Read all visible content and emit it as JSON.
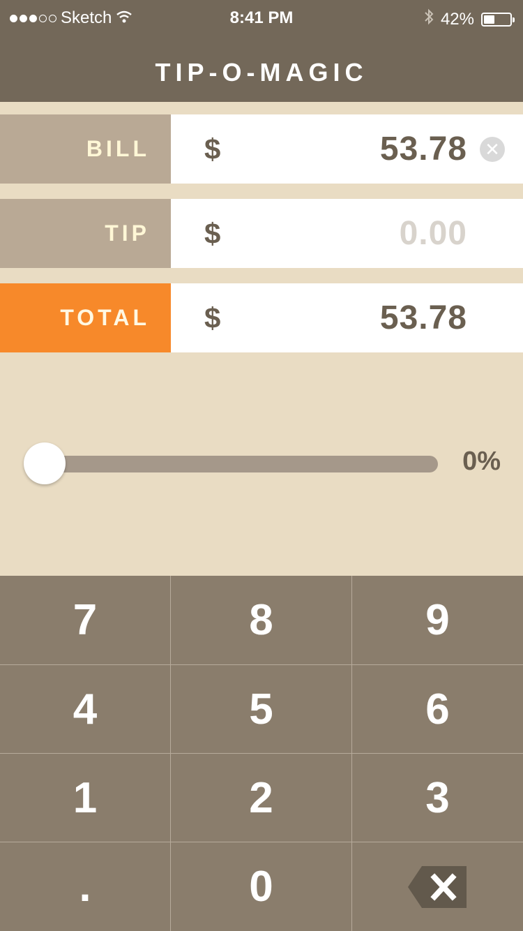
{
  "status_bar": {
    "carrier": "Sketch",
    "time": "8:41 PM",
    "battery_percent": "42%",
    "battery_level": 0.42,
    "signal_bars_filled": 3,
    "signal_bars_total": 5
  },
  "app": {
    "title": "TIP-O-MAGIC"
  },
  "rows": {
    "bill": {
      "label": "BILL",
      "currency": "$",
      "value": "53.78"
    },
    "tip": {
      "label": "TIP",
      "currency": "$",
      "placeholder": "0.00"
    },
    "total": {
      "label": "TOTAL",
      "currency": "$",
      "value": "53.78"
    }
  },
  "slider": {
    "value_label": "0%",
    "value": 0
  },
  "keypad": {
    "keys": [
      "7",
      "8",
      "9",
      "4",
      "5",
      "6",
      "1",
      "2",
      "3",
      ".",
      "0"
    ]
  },
  "colors": {
    "header": "#736859",
    "background": "#e9dcc3",
    "label": "#b9a995",
    "total_accent": "#f7892a",
    "keypad": "#8a7d6c"
  }
}
